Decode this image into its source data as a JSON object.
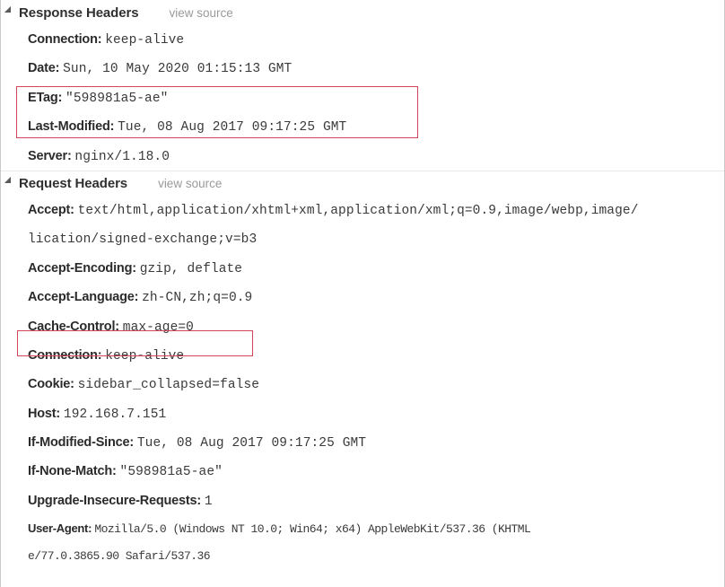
{
  "panel": {
    "accent_red": "#d5455a",
    "text_color": "#2b2b2b",
    "value_color": "#3a3a3a",
    "link_color": "#9a9a9a"
  },
  "response_section": {
    "title": "Response Headers",
    "view_source_label": "view source",
    "disclosure_icon": "triangle-down-icon",
    "headers": [
      {
        "name": "Connection:",
        "value": "keep-alive"
      },
      {
        "name": "Date:",
        "value": "Sun, 10 May 2020 01:15:13 GMT"
      },
      {
        "name": "ETag:",
        "value": "\"598981a5-ae\""
      },
      {
        "name": "Last-Modified:",
        "value": "Tue, 08 Aug 2017 09:17:25 GMT"
      },
      {
        "name": "Server:",
        "value": "nginx/1.18.0"
      }
    ]
  },
  "request_section": {
    "title": "Request Headers",
    "view_source_label": "view source",
    "disclosure_icon": "triangle-down-icon",
    "headers": [
      {
        "name": "Accept:",
        "value": "text/html,application/xhtml+xml,application/xml;q=0.9,image/webp,image/"
      },
      {
        "name": "",
        "value": "lication/signed-exchange;v=b3"
      },
      {
        "name": "Accept-Encoding:",
        "value": "gzip, deflate"
      },
      {
        "name": "Accept-Language:",
        "value": "zh-CN,zh;q=0.9"
      },
      {
        "name": "Cache-Control:",
        "value": "max-age=0"
      },
      {
        "name": "Connection:",
        "value": "keep-alive"
      },
      {
        "name": "Cookie:",
        "value": "sidebar_collapsed=false"
      },
      {
        "name": "Host:",
        "value": "192.168.7.151"
      },
      {
        "name": "If-Modified-Since:",
        "value": "Tue, 08 Aug 2017 09:17:25 GMT"
      },
      {
        "name": "If-None-Match:",
        "value": "\"598981a5-ae\""
      },
      {
        "name": "Upgrade-Insecure-Requests:",
        "value": "1"
      },
      {
        "name": "User-Agent:",
        "value": "Mozilla/5.0 (Windows NT 10.0; Win64; x64) AppleWebKit/537.36 (KHTML"
      },
      {
        "name": "",
        "value": "e/77.0.3865.90 Safari/537.36"
      }
    ]
  }
}
